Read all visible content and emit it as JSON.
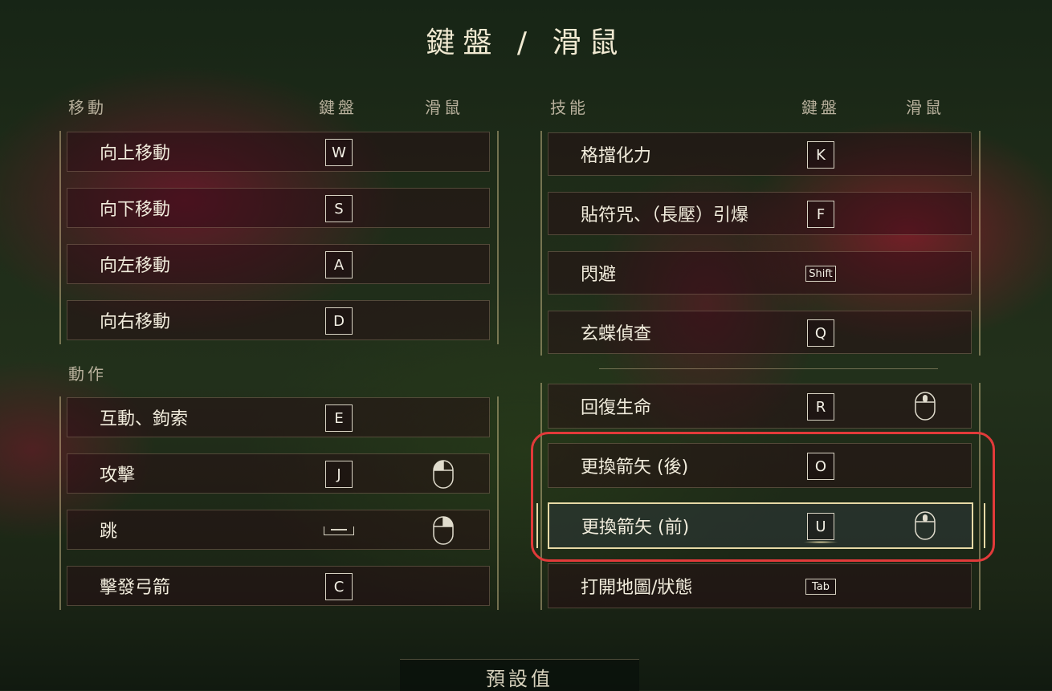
{
  "title": "鍵盤 / 滑鼠",
  "left": {
    "movement_header": "移動",
    "keyboard_col": "鍵盤",
    "mouse_col": "滑鼠",
    "actions_header": "動作",
    "movement_rows": [
      {
        "label": "向上移動",
        "key": "W"
      },
      {
        "label": "向下移動",
        "key": "S"
      },
      {
        "label": "向左移動",
        "key": "A"
      },
      {
        "label": "向右移動",
        "key": "D"
      }
    ],
    "action_rows": [
      {
        "label": "互動、鉤索",
        "key": "E"
      },
      {
        "label": "攻擊",
        "key": "J",
        "mouse": "left-mouse-button-icon"
      },
      {
        "label": "跳",
        "key": "space-bar-icon",
        "mouse": "right-mouse-button-icon"
      },
      {
        "label": "擊發弓箭",
        "key": "C"
      }
    ]
  },
  "right": {
    "skills_header": "技能",
    "keyboard_col": "鍵盤",
    "mouse_col": "滑鼠",
    "skill_rows": [
      {
        "label": "格擋化力",
        "key": "K"
      },
      {
        "label": "貼符咒、（長壓）引爆",
        "key": "F"
      },
      {
        "label": "閃避",
        "key": "Shift"
      },
      {
        "label": "玄蝶偵查",
        "key": "Q"
      }
    ],
    "other_rows": [
      {
        "label": "回復生命",
        "key": "R",
        "mouse": "middle-mouse-button-icon"
      },
      {
        "label": "更換箭矢 (後)",
        "key": "O"
      },
      {
        "label": "更換箭矢 (前)",
        "key": "U",
        "mouse": "middle-mouse-button-icon",
        "selected": true
      },
      {
        "label": "打開地圖/狀態",
        "key": "Tab"
      }
    ]
  },
  "footer": {
    "reset_label": "預設值"
  },
  "colors": {
    "selection_border": "#e7d9a6",
    "highlight_box": "#e23a3a"
  }
}
